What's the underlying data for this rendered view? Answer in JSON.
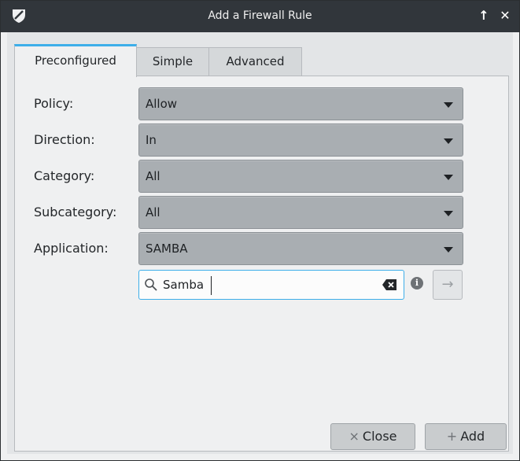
{
  "window": {
    "title": "Add a Firewall Rule",
    "up_label": "↑",
    "close_label": "✕"
  },
  "tabs": [
    {
      "label": "Preconfigured",
      "active": true
    },
    {
      "label": "Simple",
      "active": false
    },
    {
      "label": "Advanced",
      "active": false
    }
  ],
  "form": {
    "policy": {
      "label": "Policy:",
      "value": "Allow"
    },
    "direction": {
      "label": "Direction:",
      "value": "In"
    },
    "category": {
      "label": "Category:",
      "value": "All"
    },
    "subcategory": {
      "label": "Subcategory:",
      "value": "All"
    },
    "application": {
      "label": "Application:",
      "value": "SAMBA"
    }
  },
  "search": {
    "value": "Samba",
    "icon": "search-icon",
    "clear_icon": "clear-text-icon"
  },
  "info": {
    "glyph": "i"
  },
  "go": {
    "glyph": "→"
  },
  "footer": {
    "close": {
      "symbol": "×",
      "label": "Close"
    },
    "add": {
      "symbol": "+",
      "label": "Add"
    }
  },
  "colors": {
    "accent": "#3daee9",
    "titlebar": "#31363b",
    "combo": "#a9aeb2"
  }
}
